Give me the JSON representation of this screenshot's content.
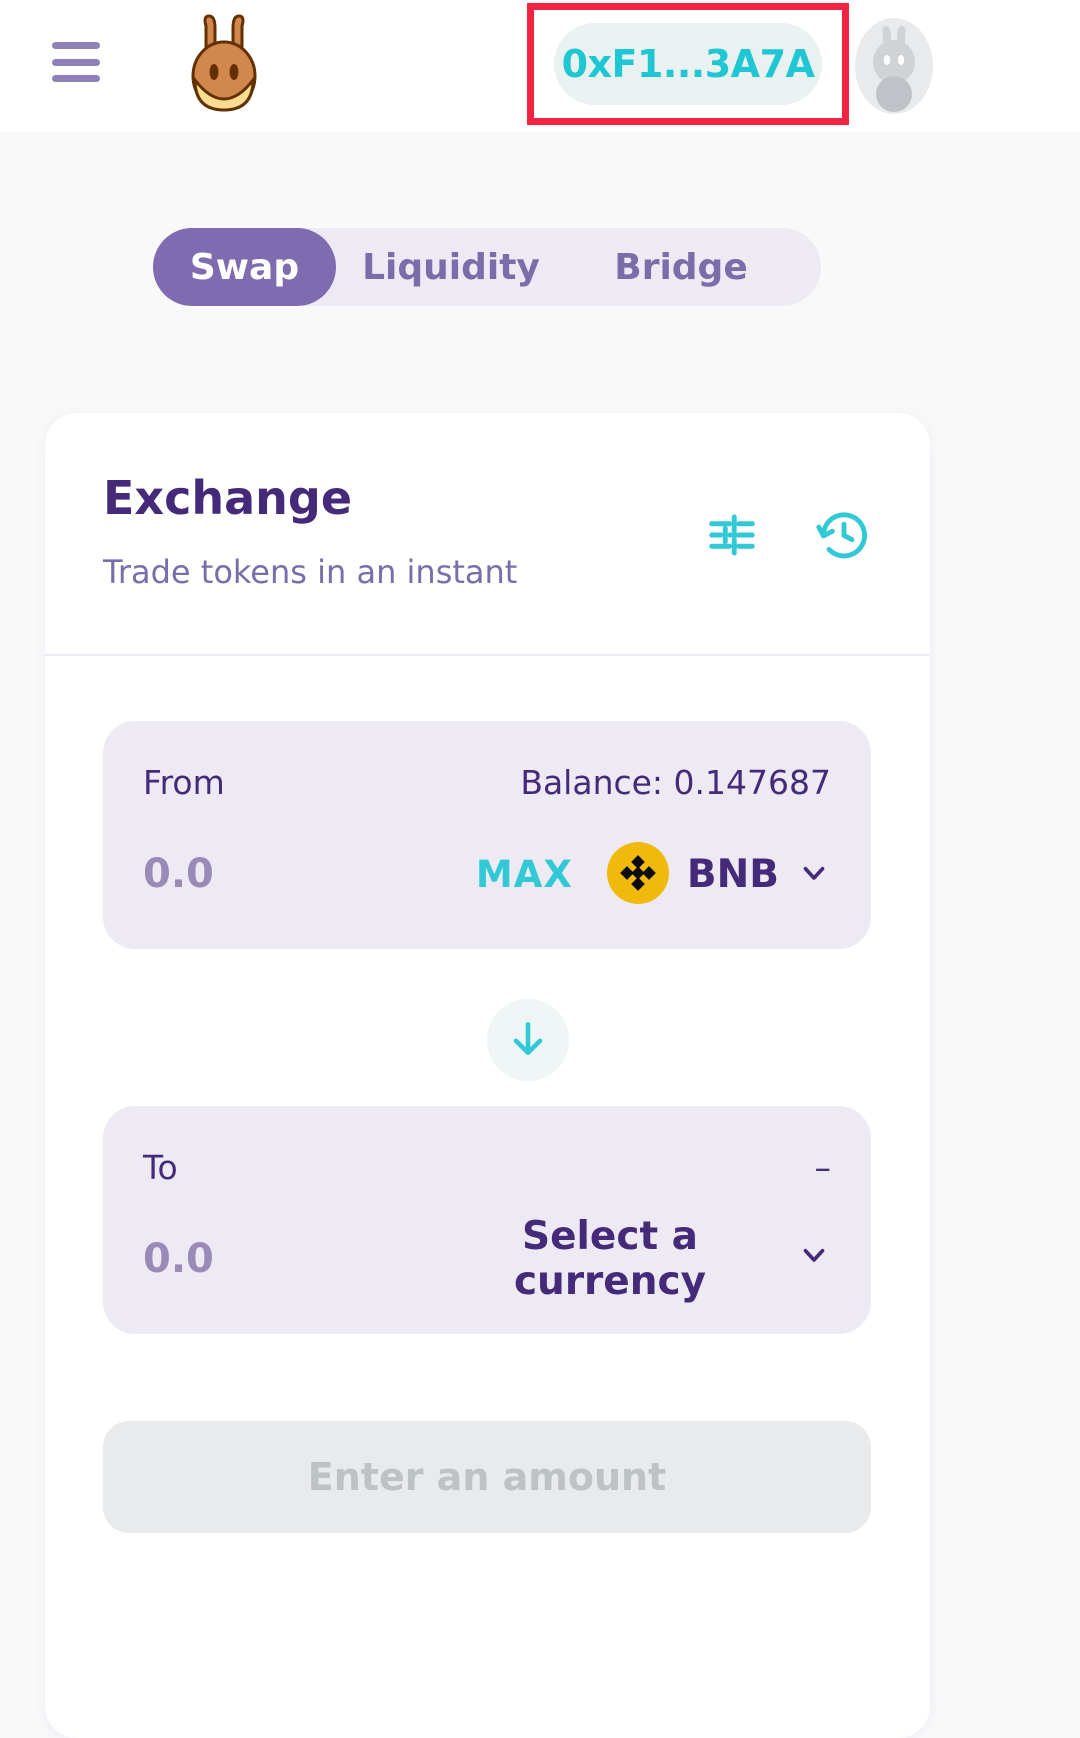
{
  "header": {
    "menu_icon": "hamburger-menu-icon",
    "logo_icon": "pancakeswap-rabbit-logo",
    "wallet_address": "0xF1...3A7A",
    "avatar_icon": "user-avatar-rabbit-icon",
    "highlight_color": "#f32440",
    "wallet_text_color": "#1fc7d4"
  },
  "tabs": [
    {
      "label": "Swap",
      "active": true
    },
    {
      "label": "Liquidity",
      "active": false
    },
    {
      "label": "Bridge",
      "active": false
    }
  ],
  "card": {
    "title": "Exchange",
    "subtitle": "Trade tokens in an instant",
    "settings_icon": "settings-sliders-icon",
    "history_icon": "transaction-history-clock-icon"
  },
  "from_panel": {
    "label": "From",
    "balance": "Balance: 0.147687",
    "amount_value": "0.0",
    "amount_placeholder": "0.0",
    "max_label": "MAX",
    "token_symbol": "BNB",
    "token_icon": "bnb-coin-icon",
    "chevron_icon": "chevron-down-icon"
  },
  "swap_toggle": {
    "icon": "arrow-down-icon"
  },
  "to_panel": {
    "label": "To",
    "balance": "–",
    "amount_value": "0.0",
    "amount_placeholder": "0.0",
    "select_label": "Select a currency",
    "chevron_icon": "chevron-down-icon"
  },
  "action": {
    "label": "Enter an amount",
    "disabled": true
  },
  "colors": {
    "primary_purple": "#452a7a",
    "muted_purple": "#7a6eaa",
    "accent_cyan": "#1fc7d4",
    "panel_bg": "#eeeaf4",
    "active_tab": "#7f6bb0",
    "bnb_gold": "#f0b90b"
  }
}
